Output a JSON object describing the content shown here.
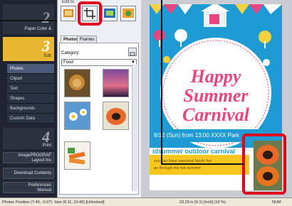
{
  "steps": {
    "step2": {
      "num": "2",
      "caption": "Paper Color &"
    },
    "step3": {
      "num": "3",
      "caption": "Edit"
    },
    "step4": {
      "num": "4",
      "caption": "Print"
    },
    "items": [
      {
        "label": "Photos",
        "active": true
      },
      {
        "label": "Clipart",
        "active": false
      },
      {
        "label": "Text",
        "active": false
      },
      {
        "label": "Shapes",
        "active": false
      },
      {
        "label": "Backgrounds",
        "active": false
      },
      {
        "label": "Custom Data",
        "active": false
      }
    ],
    "bottom_buttons": [
      {
        "line1": "ImagePROGRAF",
        "line2": "Layout Ins"
      },
      {
        "line1": "Download Contents",
        "line2": ""
      },
      {
        "line1": "Preferences",
        "line2": "Manual"
      }
    ]
  },
  "edit": {
    "label": "Edit to",
    "tabs": [
      {
        "label": "Photos",
        "active": true
      },
      {
        "label": "Frames",
        "active": false
      }
    ],
    "category_label": "Category:",
    "category_value": "Food"
  },
  "poster": {
    "title_line1": "Happy",
    "title_line2": "Summer",
    "title_line3": "Carnival",
    "date_line": "8/12 (Sun) from 13:00  XXXX Park",
    "subtitle": "idsummer outdoor carnival",
    "tag_line1": "you can have seasonal family fun",
    "tag_line2": "go through the hot summer"
  },
  "status": {
    "left": "Photos",
    "position": "Position (7.49, -0.07)",
    "size": "Size (8.11, 10.46) [Unlocked]",
    "zoom": "23.29 in (0.1) [inch] (10 %)",
    "mode": "NUM"
  },
  "colors": {
    "highlight": "#e00020",
    "poster_bg": "#1e9bd4",
    "title_pink": "#e8467c"
  }
}
